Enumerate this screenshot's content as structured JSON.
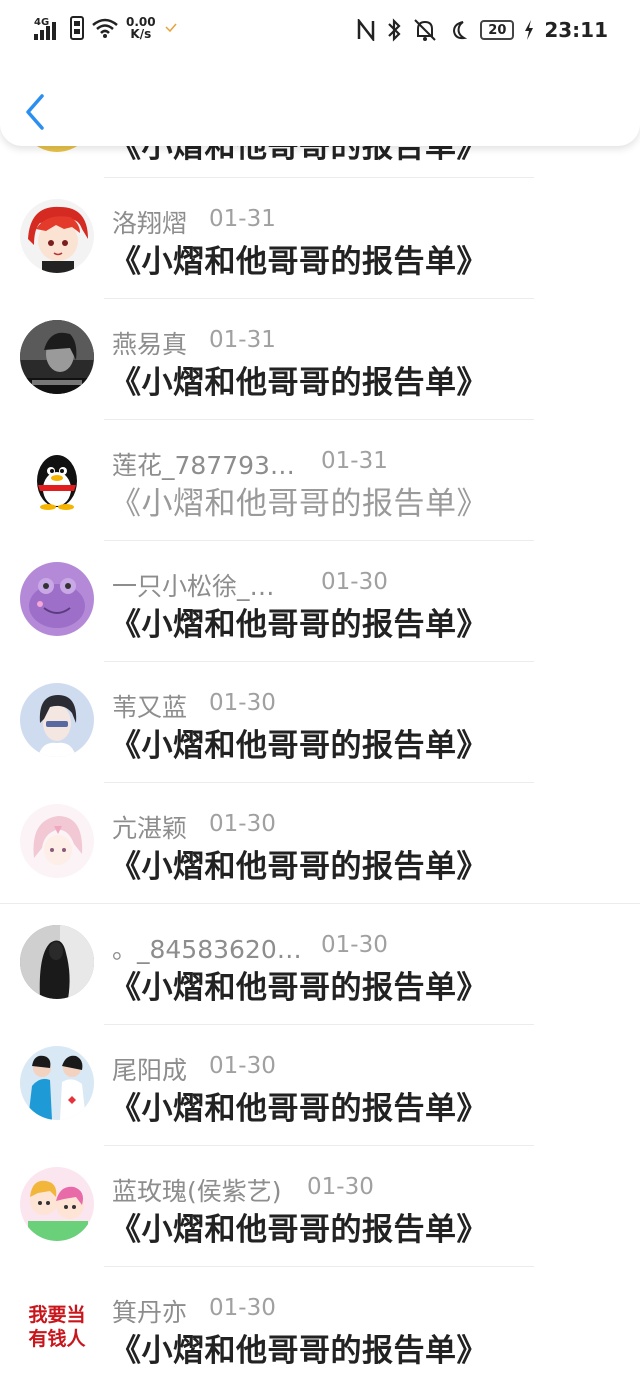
{
  "status_bar": {
    "network": "4G",
    "speed_value": "0.00",
    "speed_unit": "K/s",
    "battery": "20",
    "time": "23:11"
  },
  "header": {
    "back_icon": "chevron-left-icon",
    "accent": "#2b8ff0"
  },
  "messages": [
    {
      "name": "洛翔熠",
      "date": "01-31",
      "title": "《小熠和他哥哥的报告单》",
      "read": false
    },
    {
      "name": "燕易真",
      "date": "01-31",
      "title": "《小熠和他哥哥的报告单》",
      "read": false
    },
    {
      "name": "莲花_787793…",
      "date": "01-31",
      "title": "《小熠和他哥哥的报告单》",
      "read": true
    },
    {
      "name": "一只小松徐_…",
      "date": "01-30",
      "title": "《小熠和他哥哥的报告单》",
      "read": false
    },
    {
      "name": "苇又蓝",
      "date": "01-30",
      "title": "《小熠和他哥哥的报告单》",
      "read": false
    },
    {
      "name": "亢湛颖",
      "date": "01-30",
      "title": "《小熠和他哥哥的报告单》",
      "read": false
    },
    {
      "name": "。_84583620…",
      "date": "01-30",
      "title": "《小熠和他哥哥的报告单》",
      "read": false
    },
    {
      "name": "尾阳成",
      "date": "01-30",
      "title": "《小熠和他哥哥的报告单》",
      "read": false
    },
    {
      "name": "蓝玫瑰(侯紫艺)",
      "date": "01-30",
      "title": "《小熠和他哥哥的报告单》",
      "read": false
    },
    {
      "name": "箕丹亦",
      "date": "01-30",
      "title": "《小熠和他哥哥的报告单》",
      "read": false
    }
  ],
  "avatar_texts": {
    "last": "我要当有钱人"
  }
}
